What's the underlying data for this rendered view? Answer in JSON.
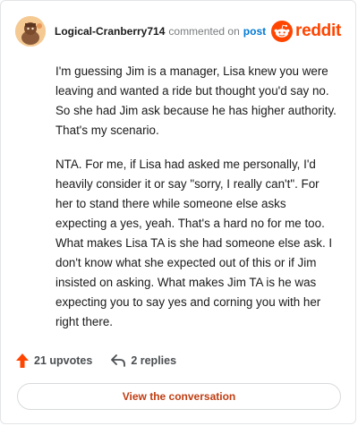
{
  "header": {
    "username": "Logical-Cranberry714",
    "action_text": "commented on",
    "post_link": "post",
    "brand_name": "reddit"
  },
  "comment": {
    "paragraphs": [
      "I'm guessing Jim is a manager, Lisa knew you were leaving and wanted a ride but thought you'd say no. So she had Jim ask because he has higher authority. That's my scenario.",
      "NTA. For me, if Lisa had asked me personally, I'd heavily consider it or say \"sorry, I really can't\". For her to stand there while someone else asks expecting a yes, yeah. That's a hard no for me too. What makes Lisa TA is she had someone else ask. I don't know what she expected out of this or if Jim insisted on asking. What makes Jim TA is he was expecting you to say yes and corning you with her right there."
    ]
  },
  "actions": {
    "upvotes_label": "21 upvotes",
    "replies_label": "2 replies"
  },
  "cta": {
    "label": "View the conversation"
  },
  "colors": {
    "brand": "#ff4500",
    "link": "#0079d3",
    "cta_text": "#c03d12"
  },
  "icons": {
    "upvote": "upvote-arrow-icon",
    "reply": "reply-arrow-icon",
    "logo": "reddit-alien-icon",
    "avatar": "user-avatar"
  }
}
